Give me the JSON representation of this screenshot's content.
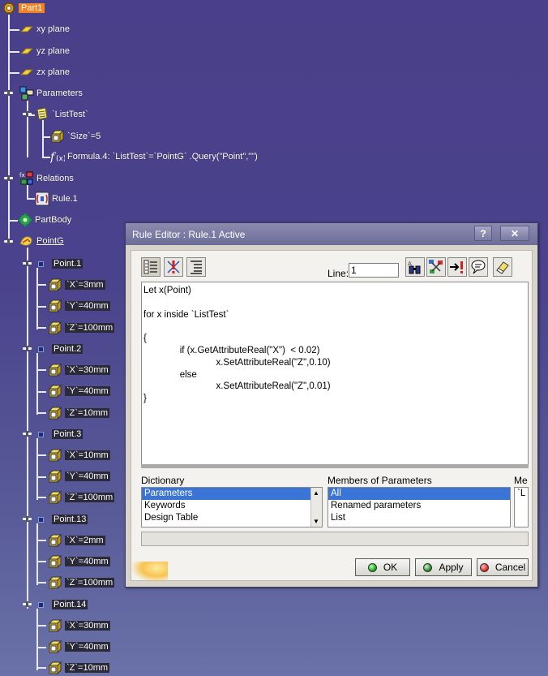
{
  "tree": {
    "root": "Part1",
    "planes": [
      "xy plane",
      "yz plane",
      "zx plane"
    ],
    "parameters": "Parameters",
    "list_test": "`ListTest`",
    "size": "`Size`=5",
    "formula": "Formula.4: `ListTest`=`PointG` .Query(\"Point\",\"\")",
    "relations": "Relations",
    "rule": "Rule.1",
    "partbody": "PartBody",
    "pointg": "PointG",
    "points": [
      {
        "name": "Point.1",
        "x": "`X`=3mm",
        "y": "`Y`=40mm",
        "z": "`Z`=100mm"
      },
      {
        "name": "Point.2",
        "x": "`X`=30mm",
        "y": "`Y`=40mm",
        "z": "`Z`=10mm"
      },
      {
        "name": "Point.3",
        "x": "`X`=10mm",
        "y": "`Y`=40mm",
        "z": "`Z`=100mm"
      },
      {
        "name": "Point.13",
        "x": "`X`=2mm",
        "y": "`Y`=40mm",
        "z": "`Z`=100mm"
      },
      {
        "name": "Point.14",
        "x": "`X`=30mm",
        "y": "`Y`=40mm",
        "z": "`Z`=10mm"
      }
    ]
  },
  "dialog": {
    "title": "Rule Editor : Rule.1 Active",
    "help_label": "?",
    "close_label": "✕",
    "line_label": "Line:",
    "line_value": "1",
    "code": [
      "Let x(Point)",
      "",
      "for x inside `ListTest`",
      "",
      "{",
      "              if (x.GetAttributeReal(\"X\")  < 0.02)",
      "                            x.SetAttributeReal(\"Z\",0.10)",
      "              else",
      "                            x.SetAttributeReal(\"Z\",0.01)",
      "}"
    ],
    "dictionary_header": "Dictionary",
    "dictionary_items": [
      "Parameters",
      "Keywords",
      "Design Table"
    ],
    "members_header": "Members of Parameters",
    "members_items": [
      "All",
      "Renamed parameters",
      "List"
    ],
    "third_header": "Me",
    "third_items": [
      "`L"
    ],
    "ok_label": "OK",
    "apply_label": "Apply",
    "cancel_label": "Cancel"
  },
  "colors": {
    "selection_orange": "#f58220",
    "list_highlight": "#3a74d6",
    "ok_green": "#1db31d",
    "apply_gray": "#6a7a6a",
    "cancel_red": "#e03030"
  }
}
